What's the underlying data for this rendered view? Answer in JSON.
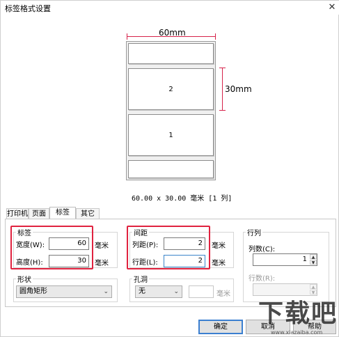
{
  "window": {
    "title": "标签格式设置",
    "close_glyph": "✕"
  },
  "preview": {
    "width_label": "60mm",
    "height_label": "30mm",
    "labels": [
      "2",
      "1"
    ],
    "summary": "60.00 x 30.00 毫米 [1 列]"
  },
  "tabs": [
    {
      "label": "打印机"
    },
    {
      "label": "页面"
    },
    {
      "label": "标签"
    },
    {
      "label": "其它"
    }
  ],
  "active_tab": "标签",
  "label_group": {
    "title": "标签",
    "width_label": "宽度(W):",
    "width_value": "60",
    "height_label": "高度(H):",
    "height_value": "30",
    "unit": "毫米"
  },
  "spacing_group": {
    "title": "间距",
    "col_label": "列距(P):",
    "col_value": "2",
    "row_label": "行距(L):",
    "row_value": "2",
    "unit": "毫米"
  },
  "rowcol_group": {
    "title": "行列",
    "cols_label": "列数(C):",
    "cols_value": "1",
    "rows_label": "行数(R):",
    "rows_value": ""
  },
  "shape_group": {
    "title": "形状",
    "selected": "圆角矩形"
  },
  "hole_group": {
    "title": "孔洞",
    "selected": "无",
    "size_value": "",
    "unit": "毫米"
  },
  "buttons": {
    "ok": "确定",
    "cancel": "取消",
    "help": "帮助"
  },
  "watermark": {
    "big": "下载吧",
    "small": "www.xiazaiba.com"
  },
  "colors": {
    "highlight": "#e0223f",
    "dimension": "#d6224a",
    "focus": "#3a84c9"
  }
}
